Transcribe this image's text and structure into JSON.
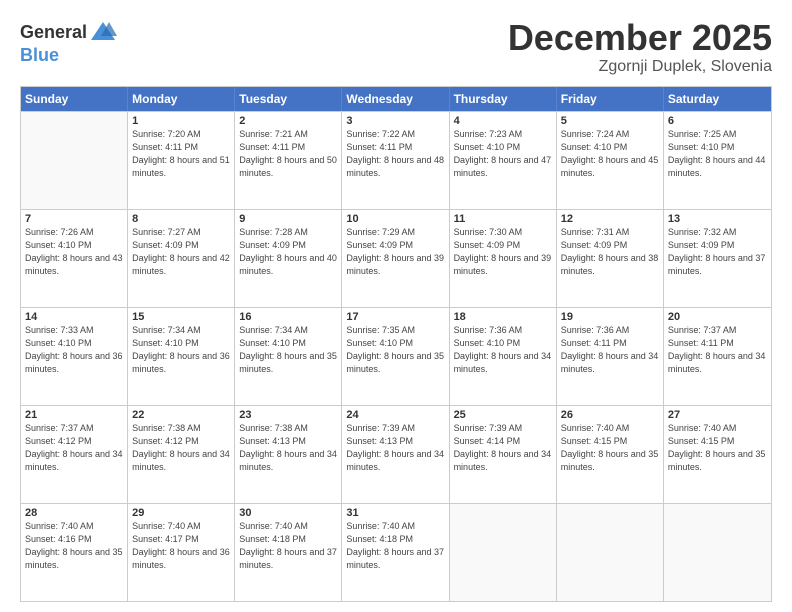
{
  "header": {
    "logo_general": "General",
    "logo_blue": "Blue",
    "month": "December 2025",
    "location": "Zgornji Duplek, Slovenia"
  },
  "days": [
    "Sunday",
    "Monday",
    "Tuesday",
    "Wednesday",
    "Thursday",
    "Friday",
    "Saturday"
  ],
  "weeks": [
    [
      {
        "day": "",
        "sunrise": "",
        "sunset": "",
        "daylight": ""
      },
      {
        "day": "1",
        "sunrise": "Sunrise: 7:20 AM",
        "sunset": "Sunset: 4:11 PM",
        "daylight": "Daylight: 8 hours and 51 minutes."
      },
      {
        "day": "2",
        "sunrise": "Sunrise: 7:21 AM",
        "sunset": "Sunset: 4:11 PM",
        "daylight": "Daylight: 8 hours and 50 minutes."
      },
      {
        "day": "3",
        "sunrise": "Sunrise: 7:22 AM",
        "sunset": "Sunset: 4:11 PM",
        "daylight": "Daylight: 8 hours and 48 minutes."
      },
      {
        "day": "4",
        "sunrise": "Sunrise: 7:23 AM",
        "sunset": "Sunset: 4:10 PM",
        "daylight": "Daylight: 8 hours and 47 minutes."
      },
      {
        "day": "5",
        "sunrise": "Sunrise: 7:24 AM",
        "sunset": "Sunset: 4:10 PM",
        "daylight": "Daylight: 8 hours and 45 minutes."
      },
      {
        "day": "6",
        "sunrise": "Sunrise: 7:25 AM",
        "sunset": "Sunset: 4:10 PM",
        "daylight": "Daylight: 8 hours and 44 minutes."
      }
    ],
    [
      {
        "day": "7",
        "sunrise": "Sunrise: 7:26 AM",
        "sunset": "Sunset: 4:10 PM",
        "daylight": "Daylight: 8 hours and 43 minutes."
      },
      {
        "day": "8",
        "sunrise": "Sunrise: 7:27 AM",
        "sunset": "Sunset: 4:09 PM",
        "daylight": "Daylight: 8 hours and 42 minutes."
      },
      {
        "day": "9",
        "sunrise": "Sunrise: 7:28 AM",
        "sunset": "Sunset: 4:09 PM",
        "daylight": "Daylight: 8 hours and 40 minutes."
      },
      {
        "day": "10",
        "sunrise": "Sunrise: 7:29 AM",
        "sunset": "Sunset: 4:09 PM",
        "daylight": "Daylight: 8 hours and 39 minutes."
      },
      {
        "day": "11",
        "sunrise": "Sunrise: 7:30 AM",
        "sunset": "Sunset: 4:09 PM",
        "daylight": "Daylight: 8 hours and 39 minutes."
      },
      {
        "day": "12",
        "sunrise": "Sunrise: 7:31 AM",
        "sunset": "Sunset: 4:09 PM",
        "daylight": "Daylight: 8 hours and 38 minutes."
      },
      {
        "day": "13",
        "sunrise": "Sunrise: 7:32 AM",
        "sunset": "Sunset: 4:09 PM",
        "daylight": "Daylight: 8 hours and 37 minutes."
      }
    ],
    [
      {
        "day": "14",
        "sunrise": "Sunrise: 7:33 AM",
        "sunset": "Sunset: 4:10 PM",
        "daylight": "Daylight: 8 hours and 36 minutes."
      },
      {
        "day": "15",
        "sunrise": "Sunrise: 7:34 AM",
        "sunset": "Sunset: 4:10 PM",
        "daylight": "Daylight: 8 hours and 36 minutes."
      },
      {
        "day": "16",
        "sunrise": "Sunrise: 7:34 AM",
        "sunset": "Sunset: 4:10 PM",
        "daylight": "Daylight: 8 hours and 35 minutes."
      },
      {
        "day": "17",
        "sunrise": "Sunrise: 7:35 AM",
        "sunset": "Sunset: 4:10 PM",
        "daylight": "Daylight: 8 hours and 35 minutes."
      },
      {
        "day": "18",
        "sunrise": "Sunrise: 7:36 AM",
        "sunset": "Sunset: 4:10 PM",
        "daylight": "Daylight: 8 hours and 34 minutes."
      },
      {
        "day": "19",
        "sunrise": "Sunrise: 7:36 AM",
        "sunset": "Sunset: 4:11 PM",
        "daylight": "Daylight: 8 hours and 34 minutes."
      },
      {
        "day": "20",
        "sunrise": "Sunrise: 7:37 AM",
        "sunset": "Sunset: 4:11 PM",
        "daylight": "Daylight: 8 hours and 34 minutes."
      }
    ],
    [
      {
        "day": "21",
        "sunrise": "Sunrise: 7:37 AM",
        "sunset": "Sunset: 4:12 PM",
        "daylight": "Daylight: 8 hours and 34 minutes."
      },
      {
        "day": "22",
        "sunrise": "Sunrise: 7:38 AM",
        "sunset": "Sunset: 4:12 PM",
        "daylight": "Daylight: 8 hours and 34 minutes."
      },
      {
        "day": "23",
        "sunrise": "Sunrise: 7:38 AM",
        "sunset": "Sunset: 4:13 PM",
        "daylight": "Daylight: 8 hours and 34 minutes."
      },
      {
        "day": "24",
        "sunrise": "Sunrise: 7:39 AM",
        "sunset": "Sunset: 4:13 PM",
        "daylight": "Daylight: 8 hours and 34 minutes."
      },
      {
        "day": "25",
        "sunrise": "Sunrise: 7:39 AM",
        "sunset": "Sunset: 4:14 PM",
        "daylight": "Daylight: 8 hours and 34 minutes."
      },
      {
        "day": "26",
        "sunrise": "Sunrise: 7:40 AM",
        "sunset": "Sunset: 4:15 PM",
        "daylight": "Daylight: 8 hours and 35 minutes."
      },
      {
        "day": "27",
        "sunrise": "Sunrise: 7:40 AM",
        "sunset": "Sunset: 4:15 PM",
        "daylight": "Daylight: 8 hours and 35 minutes."
      }
    ],
    [
      {
        "day": "28",
        "sunrise": "Sunrise: 7:40 AM",
        "sunset": "Sunset: 4:16 PM",
        "daylight": "Daylight: 8 hours and 35 minutes."
      },
      {
        "day": "29",
        "sunrise": "Sunrise: 7:40 AM",
        "sunset": "Sunset: 4:17 PM",
        "daylight": "Daylight: 8 hours and 36 minutes."
      },
      {
        "day": "30",
        "sunrise": "Sunrise: 7:40 AM",
        "sunset": "Sunset: 4:18 PM",
        "daylight": "Daylight: 8 hours and 37 minutes."
      },
      {
        "day": "31",
        "sunrise": "Sunrise: 7:40 AM",
        "sunset": "Sunset: 4:18 PM",
        "daylight": "Daylight: 8 hours and 37 minutes."
      },
      {
        "day": "",
        "sunrise": "",
        "sunset": "",
        "daylight": ""
      },
      {
        "day": "",
        "sunrise": "",
        "sunset": "",
        "daylight": ""
      },
      {
        "day": "",
        "sunrise": "",
        "sunset": "",
        "daylight": ""
      }
    ]
  ]
}
